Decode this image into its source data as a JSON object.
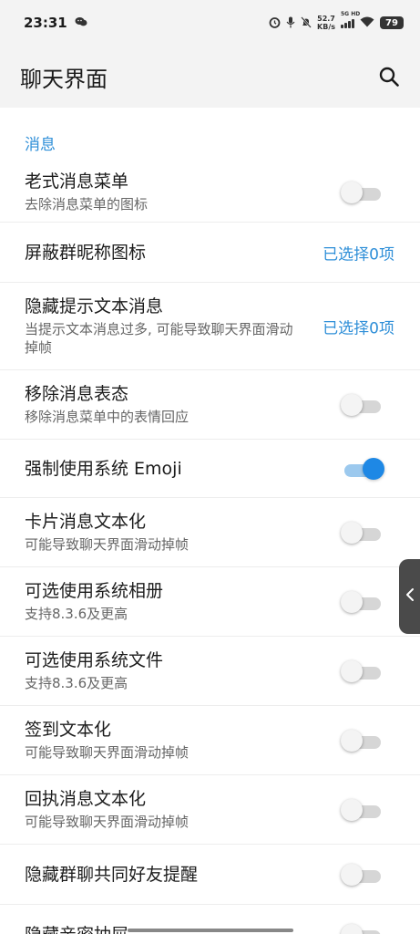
{
  "status_bar": {
    "time": "23:31",
    "net_speed_value": "52.7",
    "net_speed_unit": "KB/s",
    "signal_label": "5G HD",
    "battery": "79",
    "icons": [
      "wechat-icon",
      "alarm-icon",
      "mic-icon",
      "bell-off-icon",
      "signal-icon",
      "wifi-icon",
      "battery-icon"
    ]
  },
  "app_bar": {
    "title": "聊天界面",
    "search_icon": "search-icon"
  },
  "section": {
    "title": "消息"
  },
  "settings": [
    {
      "title": "老式消息菜单",
      "subtitle": "去除消息菜单的图标",
      "control": "switch",
      "on": false
    },
    {
      "title": "屏蔽群昵称图标",
      "control": "value",
      "value": "已选择0项"
    },
    {
      "title": "隐藏提示文本消息",
      "subtitle": "当提示文本消息过多, 可能导致聊天界面滑动掉帧",
      "control": "value",
      "value": "已选择0项"
    },
    {
      "title": "移除消息表态",
      "subtitle": "移除消息菜单中的表情回应",
      "control": "switch",
      "on": false
    },
    {
      "title": "强制使用系统 Emoji",
      "control": "switch",
      "on": true
    },
    {
      "title": "卡片消息文本化",
      "subtitle": "可能导致聊天界面滑动掉帧",
      "control": "switch",
      "on": false
    },
    {
      "title": "可选使用系统相册",
      "subtitle": "支持8.3.6及更高",
      "control": "switch",
      "on": false
    },
    {
      "title": "可选使用系统文件",
      "subtitle": "支持8.3.6及更高",
      "control": "switch",
      "on": false
    },
    {
      "title": "签到文本化",
      "subtitle": "可能导致聊天界面滑动掉帧",
      "control": "switch",
      "on": false
    },
    {
      "title": "回执消息文本化",
      "subtitle": "可能导致聊天界面滑动掉帧",
      "control": "switch",
      "on": false
    },
    {
      "title": "隐藏群聊共同好友提醒",
      "control": "switch",
      "on": false
    },
    {
      "title": "隐藏亲密抽屉",
      "control": "switch",
      "on": false
    }
  ],
  "colors": {
    "accent": "#2f8fd8",
    "switch_on": "#1e88e5",
    "header_bg": "#f3f3f3"
  },
  "side_handle_icon": "chevron-left-icon"
}
